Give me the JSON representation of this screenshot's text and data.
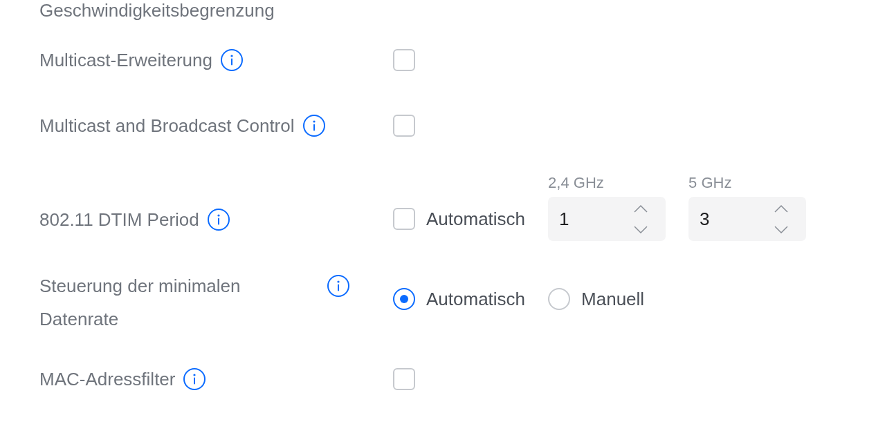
{
  "section_heading": "Geschwindigkeitsbegrenzung",
  "settings": [
    {
      "label": "Multicast-Erweiterung",
      "control": {
        "kind": "checkbox",
        "checked": false
      }
    },
    {
      "label": "Multicast and Broadcast Control",
      "control": {
        "kind": "checkbox",
        "checked": false
      }
    },
    {
      "label": "802.11 DTIM Period",
      "control": {
        "kind": "spinners",
        "auto": {
          "label": "Automatisch",
          "checked": false
        },
        "fields": [
          {
            "band": "2,4 GHz",
            "value": "1"
          },
          {
            "band": "5 GHz",
            "value": "3"
          }
        ]
      }
    },
    {
      "label": "Steuerung der minimalen Datenrate",
      "control": {
        "kind": "radios",
        "options": [
          {
            "label": "Automatisch",
            "selected": true
          },
          {
            "label": "Manuell",
            "selected": false
          }
        ]
      }
    },
    {
      "label": "MAC-Adressfilter",
      "control": {
        "kind": "checkbox",
        "checked": false
      }
    }
  ]
}
